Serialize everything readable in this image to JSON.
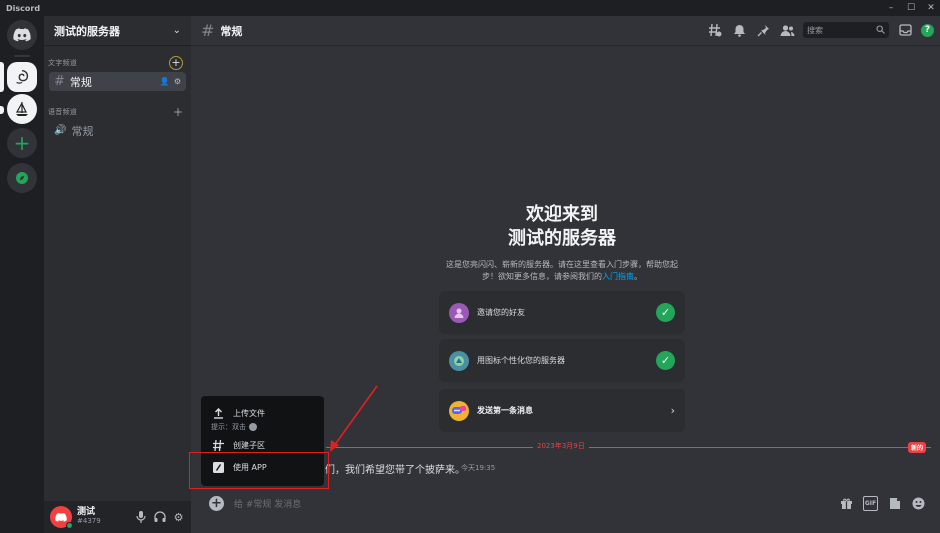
{
  "window": {
    "app_name": "Discord"
  },
  "guild": {
    "name": "测试的服务器"
  },
  "categories": [
    {
      "label": "文字频道",
      "channels": [
        {
          "name": "常规",
          "active": true
        }
      ]
    },
    {
      "label": "语音频道",
      "channels": [
        {
          "name": "常规",
          "active": false
        }
      ]
    }
  ],
  "channel": {
    "title": "常规"
  },
  "toolbar": {
    "search_placeholder": "搜索"
  },
  "welcome": {
    "title_line1": "欢迎来到",
    "title_line2": "测试的服务器",
    "desc": "这是您亮闪闪、崭新的服务器。请在这里查看入门步骤，帮助您起步！欲知更多信息，请参阅我们的",
    "desc_link": "入门指南",
    "desc_end": "。"
  },
  "tasks": [
    {
      "label": "邀请您的好友",
      "done": true
    },
    {
      "label": "用图标个性化您的服务器",
      "done": true
    },
    {
      "label": "发送第一条消息",
      "done": false
    }
  ],
  "divider": {
    "date": "2023年3月9日",
    "badge": "新的"
  },
  "message": {
    "text": "们，我们希望您带了个披萨来。",
    "time": "今天19:35"
  },
  "composer": {
    "placeholder": "给 #常规 发消息"
  },
  "popup": {
    "upload_label": "上传文件",
    "hint": "提示：双击",
    "thread_label": "创建子区",
    "app_label": "使用 APP"
  },
  "user": {
    "name": "测试",
    "tag": "#4379"
  },
  "colors": {
    "accent_green": "#23a55a",
    "danger_red": "#f23f42",
    "annotation_red": "#e02020",
    "link_blue": "#00a8fc"
  }
}
